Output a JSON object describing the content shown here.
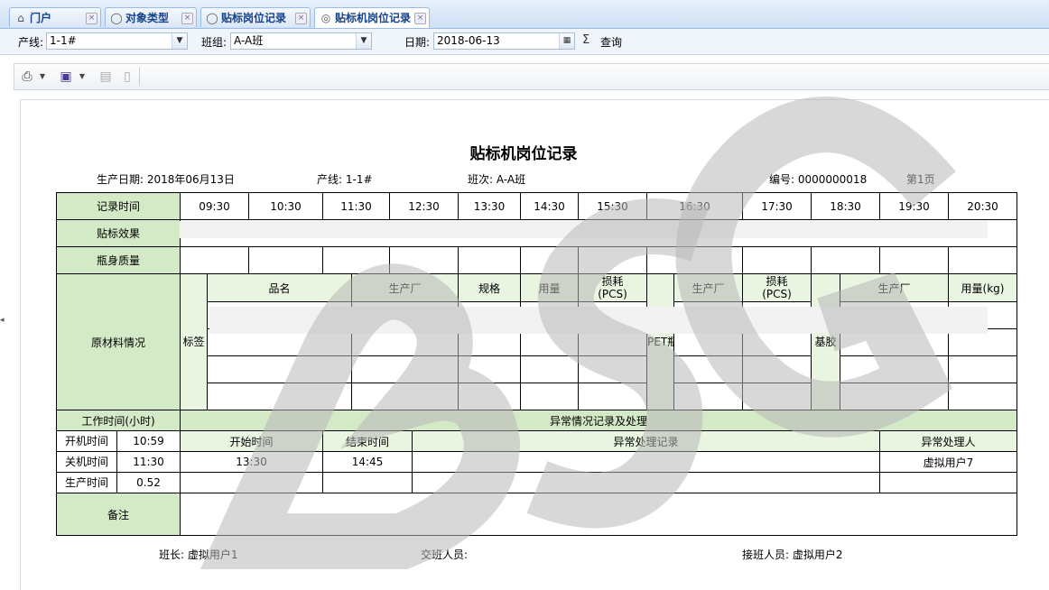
{
  "tabs": [
    {
      "label": "门户",
      "icon": "home-icon"
    },
    {
      "label": "对象类型",
      "icon": "chat-bubble-icon"
    },
    {
      "label": "贴标岗位记录",
      "icon": "chat-bubble-icon"
    },
    {
      "label": "贴标机岗位记录",
      "icon": "chat-bubbles-icon"
    }
  ],
  "filters": {
    "line_label": "产线:",
    "line_value": "1-1#",
    "team_label": "班组:",
    "team_value": "A-A班",
    "date_label": "日期:",
    "date_value": "2018-06-13",
    "sigma": "Σ",
    "query_label": "查询"
  },
  "report": {
    "title": "贴标机岗位记录",
    "meta": {
      "prod_date": "生产日期: 2018年06月13日",
      "line": "产线: 1-1#",
      "shift": "班次: A-A班",
      "number": "编号: 0000000018",
      "page": "第1页"
    },
    "row_labels": {
      "record_time": "记录时间",
      "label_effect": "贴标效果",
      "bottle_quality": "瓶身质量",
      "material": "原材料情况"
    },
    "times": [
      "09:30",
      "10:30",
      "11:30",
      "12:30",
      "13:30",
      "14:30",
      "15:30",
      "16:30",
      "17:30",
      "18:30",
      "19:30",
      "20:30"
    ],
    "material_headers": {
      "product_name": "品名",
      "maker1": "生产厂",
      "spec": "规格",
      "amount": "用量",
      "loss1_a": "损耗",
      "loss1_b": "(PCS)",
      "maker2": "生产厂",
      "loss2_a": "损耗",
      "loss2_b": "(PCS)",
      "maker3": "生产厂",
      "amount_kg": "用量(kg)"
    },
    "material_groups": {
      "label": "标签",
      "pet": "PET瓶",
      "glue": "基胶"
    },
    "work_section": {
      "work_time": "工作时间(小时)",
      "abnormal_title": "异常情况记录及处理",
      "start_label": "开机时间",
      "start_value": "10:59",
      "stop_label": "关机时间",
      "stop_value": "11:30",
      "prod_label": "生产时间",
      "prod_value": "0.52",
      "col_start": "开始时间",
      "col_end": "结束时间",
      "col_record": "异常处理记录",
      "col_handler": "异常处理人",
      "row1_start": "13:30",
      "row1_end": "14:45",
      "row1_handler": "虚拟用户7",
      "remark": "备注"
    },
    "footer": {
      "leader": "班长: 虚拟用户1",
      "handover": "交班人员:",
      "receiver": "接班人员: 虚拟用户2"
    }
  },
  "colors": {
    "accent": "#15428b",
    "header_green": "#d4e9c6",
    "light_green": "#e9f4e1"
  }
}
